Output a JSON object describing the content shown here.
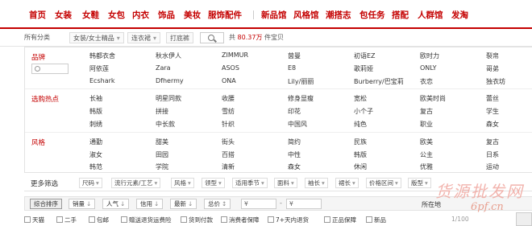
{
  "nav": {
    "items": [
      "首页",
      "女装",
      "女鞋",
      "女包",
      "内衣",
      "饰品",
      "美妆",
      "服饰配件",
      "新品馆",
      "风格馆",
      "潮搭志",
      "包任务",
      "搭配",
      "人群馆",
      "发淘"
    ]
  },
  "breadcrumb": {
    "all_label": "所有分类",
    "category": "女装/女士精品",
    "sub_category": "连衣裙",
    "keyword": "打底裤",
    "count_prefix": "共",
    "count_value": "80.37万",
    "count_suffix": "件宝贝"
  },
  "brand": {
    "label": "品牌",
    "rows": [
      [
        "韩都衣舍",
        "秋水伊人",
        "ZIMMUR",
        "茵曼",
        "初语EZ",
        "欧时力",
        "裂帛"
      ],
      [
        "阿依莲",
        "Zara",
        "ASOS",
        "E8",
        "歌莉娅",
        "ONLY",
        "哥弟"
      ],
      [
        "Ecshark",
        "Dfhermy",
        "ONA",
        "Lily/丽丽",
        "Burberry/巴宝莉",
        "衣恋",
        "独衣坊"
      ]
    ]
  },
  "hot": {
    "label": "选购热点",
    "rows": [
      [
        "长袖",
        "明星同款",
        "收腰",
        "修身显瘦",
        "宽松",
        "欧美时尚",
        "蕾丝"
      ],
      [
        "韩版",
        "拼接",
        "雪纺",
        "印花",
        "小个子",
        "复古",
        "学生"
      ],
      [
        "刺绣",
        "中长款",
        "针织",
        "中国风",
        "纯色",
        "职业",
        "森女"
      ]
    ]
  },
  "style": {
    "label": "风格",
    "rows": [
      [
        "通勤",
        "甜美",
        "街头",
        "简约",
        "民族",
        "欧美",
        "复古"
      ],
      [
        "淑女",
        "田园",
        "百搭",
        "中性",
        "韩版",
        "公主",
        "日系"
      ],
      [
        "韩范",
        "学院",
        "清新",
        "森女",
        "休闲",
        "优雅",
        "运动"
      ]
    ]
  },
  "more": {
    "label": "更多筛选",
    "dropdowns": [
      "尺码",
      "流行元素/工艺",
      "风格",
      "领型",
      "适用季节",
      "面料",
      "袖长",
      "裙长",
      "价格区间",
      "版型"
    ]
  },
  "sort": {
    "options": [
      "综合排序",
      "销量",
      "人气",
      "信用",
      "最新",
      "总价"
    ],
    "price_min": "¥",
    "price_max": "¥",
    "ship_label": "所在地"
  },
  "filters": {
    "checkboxes": [
      "天猫",
      "二手",
      "包邮",
      "赠送退货运费险",
      "货到付款",
      "消费者保障",
      "7+天内退货",
      "正品保障",
      "新品"
    ]
  },
  "watermark": {
    "text": "货源批发网",
    "url": "6pf.cn"
  },
  "pager": "1/100"
}
